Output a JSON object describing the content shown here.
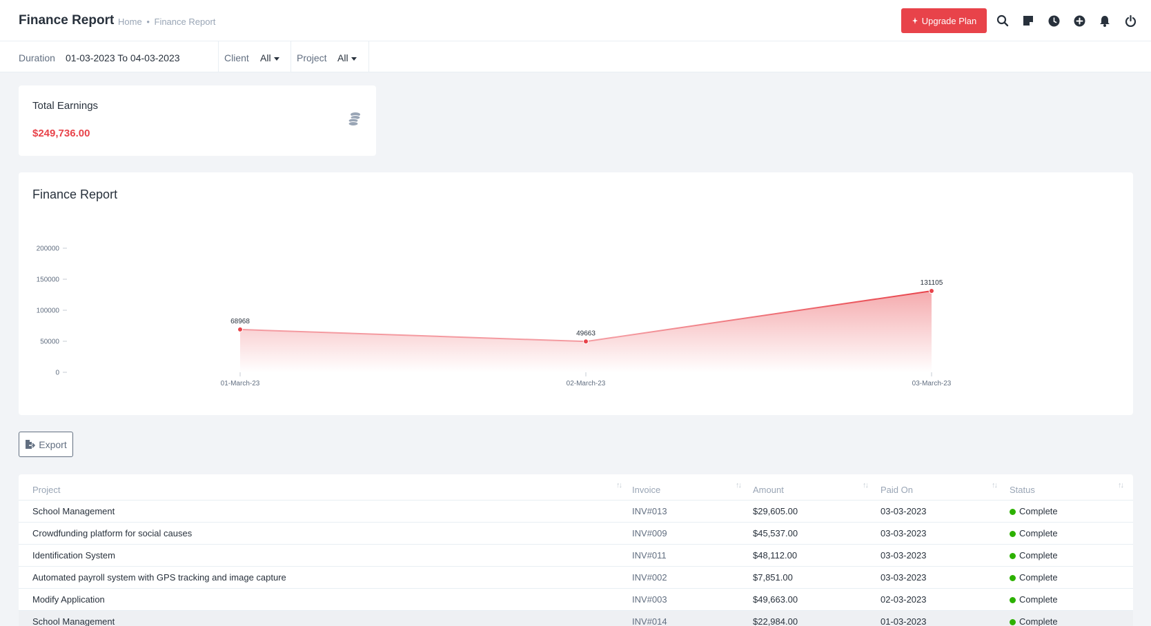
{
  "header": {
    "title": "Finance Report",
    "breadcrumb": {
      "home": "Home",
      "sep": "•",
      "current": "Finance Report"
    },
    "upgrade_label": "Upgrade Plan",
    "icons": [
      "search-icon",
      "sticky-note-icon",
      "clock-icon",
      "plus-circle-icon",
      "bell-icon",
      "power-icon"
    ]
  },
  "filters": {
    "duration_label": "Duration",
    "duration_value": "01-03-2023 To 04-03-2023",
    "client_label": "Client",
    "client_value": "All",
    "project_label": "Project",
    "project_value": "All"
  },
  "earnings": {
    "title": "Total Earnings",
    "value": "$249,736.00",
    "icon": "coins-icon"
  },
  "chart_section": {
    "title": "Finance Report"
  },
  "chart_data": {
    "type": "area",
    "categories": [
      "01-March-23",
      "02-March-23",
      "03-March-23"
    ],
    "series": [
      {
        "values": [
          68968,
          49663,
          131105
        ]
      }
    ],
    "yticks": [
      0,
      50000,
      100000,
      150000,
      200000
    ],
    "ylim": [
      0,
      200000
    ],
    "title": "",
    "xlabel": "",
    "ylabel": "",
    "grid": false,
    "color": "#e8434a"
  },
  "export_label": "Export",
  "table": {
    "columns": [
      "Project",
      "Invoice",
      "Amount",
      "Paid On",
      "Status"
    ],
    "rows": [
      {
        "project": "School Management",
        "invoice": "INV#013",
        "amount": "$29,605.00",
        "paid_on": "03-03-2023",
        "status": "Complete"
      },
      {
        "project": "Crowdfunding platform for social causes",
        "invoice": "INV#009",
        "amount": "$45,537.00",
        "paid_on": "03-03-2023",
        "status": "Complete"
      },
      {
        "project": "Identification System",
        "invoice": "INV#011",
        "amount": "$48,112.00",
        "paid_on": "03-03-2023",
        "status": "Complete"
      },
      {
        "project": "Automated payroll system with GPS tracking and image capture",
        "invoice": "INV#002",
        "amount": "$7,851.00",
        "paid_on": "03-03-2023",
        "status": "Complete"
      },
      {
        "project": "Modify Application",
        "invoice": "INV#003",
        "amount": "$49,663.00",
        "paid_on": "02-03-2023",
        "status": "Complete"
      },
      {
        "project": "School Management",
        "invoice": "INV#014",
        "amount": "$22,984.00",
        "paid_on": "01-03-2023",
        "status": "Complete"
      }
    ]
  },
  "colors": {
    "accent": "#e8434a",
    "status_complete": "#2cb100"
  }
}
